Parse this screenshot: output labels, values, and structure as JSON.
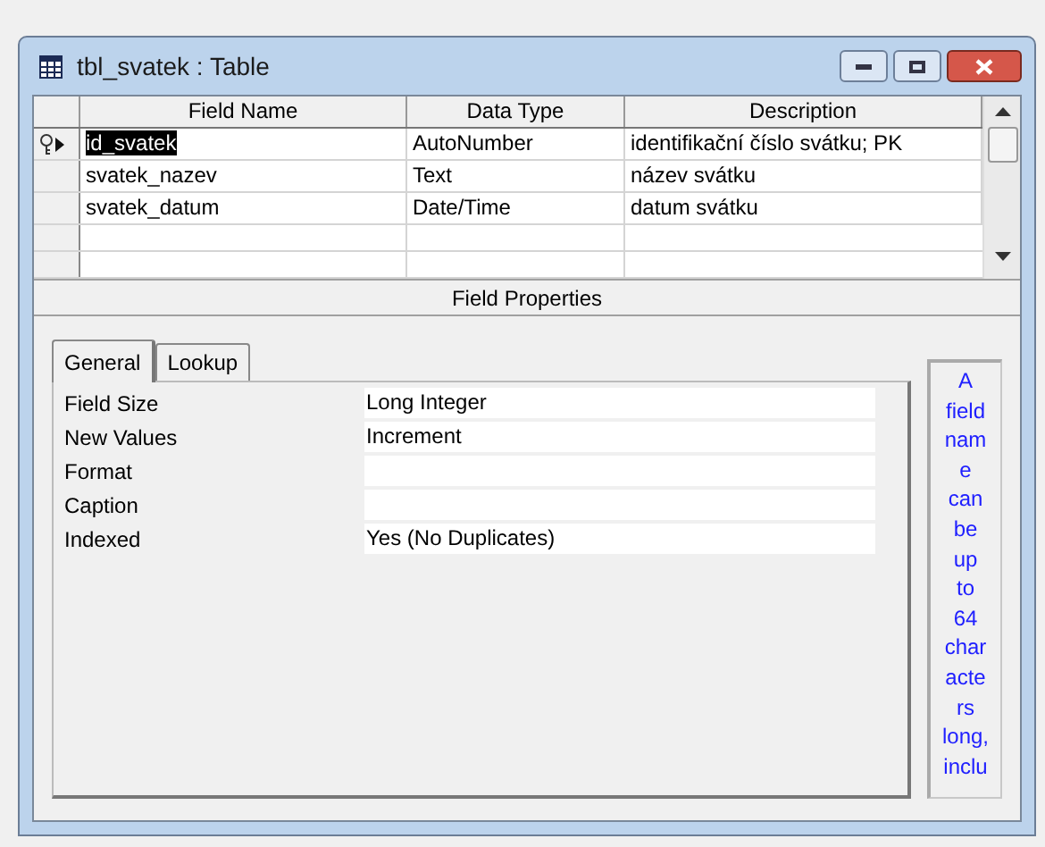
{
  "window": {
    "title": "tbl_svatek : Table"
  },
  "grid": {
    "columns": [
      "Field Name",
      "Data Type",
      "Description"
    ],
    "rows": [
      {
        "cells": [
          "id_svatek",
          "AutoNumber",
          "identifikační číslo svátku; PK"
        ],
        "primary_key": true,
        "current": true
      },
      {
        "cells": [
          "svatek_nazev",
          "Text",
          "název svátku"
        ],
        "primary_key": false,
        "current": false
      },
      {
        "cells": [
          "svatek_datum",
          "Date/Time",
          "datum svátku"
        ],
        "primary_key": false,
        "current": false
      }
    ]
  },
  "field_properties": {
    "title": "Field Properties",
    "tabs": [
      {
        "label": "General",
        "selected": true
      },
      {
        "label": "Lookup",
        "selected": false
      }
    ],
    "properties": [
      {
        "label": "Field Size",
        "value": "Long Integer"
      },
      {
        "label": "New Values",
        "value": "Increment"
      },
      {
        "label": "Format"
      },
      {
        "label": "Caption"
      },
      {
        "label": "Indexed",
        "value": "Yes (No Duplicates)"
      }
    ],
    "help_lines": [
      "A",
      "field",
      "nam",
      "e",
      "can",
      "be",
      "up",
      "to",
      "64",
      "char",
      "acte",
      "rs",
      "long,",
      "inclu"
    ]
  }
}
